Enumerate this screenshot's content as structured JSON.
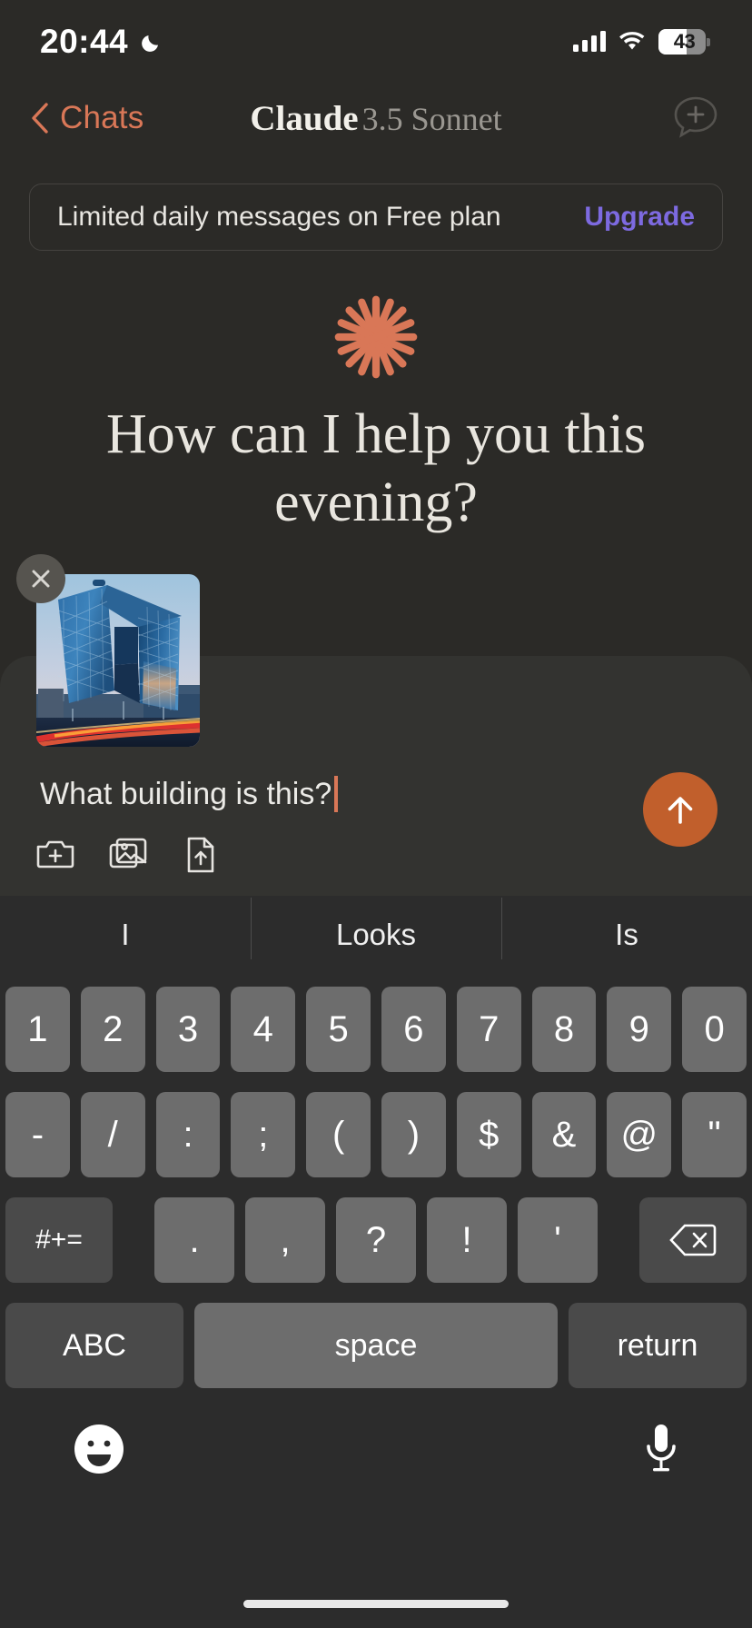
{
  "statusbar": {
    "time": "20:44",
    "moon_icon": "crescent-moon-icon",
    "signal_icon": "cellular-signal-icon",
    "wifi_icon": "wifi-icon",
    "battery_percent": "43",
    "battery_fill_ratio": 0.6
  },
  "header": {
    "back_label": "Chats",
    "back_icon": "chevron-left-icon",
    "title_main": "Claude",
    "title_sub": "3.5 Sonnet",
    "new_chat_icon": "new-chat-icon"
  },
  "banner": {
    "message": "Limited daily messages on Free plan",
    "cta_label": "Upgrade",
    "cta_color": "#7d6ae0"
  },
  "hero": {
    "logo_icon": "claude-starburst-icon",
    "logo_color": "#d97757",
    "greeting": "How can I help you this evening?"
  },
  "composer": {
    "attachment": {
      "remove_icon": "close-icon",
      "image_alt": "CCTV Headquarters building at dusk"
    },
    "input_value": "What building is this?",
    "caret_color": "#d97757",
    "tools": [
      {
        "icon": "camera-add-icon",
        "label": "Take photo"
      },
      {
        "icon": "photo-library-icon",
        "label": "Photo library"
      },
      {
        "icon": "file-upload-icon",
        "label": "Upload file"
      }
    ],
    "send_icon": "arrow-up-icon",
    "send_color": "#c15f2c"
  },
  "keyboard": {
    "suggestions": [
      "I",
      "Looks",
      "Is"
    ],
    "rows": [
      [
        "1",
        "2",
        "3",
        "4",
        "5",
        "6",
        "7",
        "8",
        "9",
        "0"
      ],
      [
        "-",
        "/",
        ":",
        ";",
        "(",
        ")",
        "$",
        "&",
        "@",
        "\""
      ],
      [
        "#+=",
        ".",
        ",",
        "?",
        "!",
        "'",
        "delete-icon"
      ],
      [
        "ABC",
        "space",
        "return"
      ]
    ],
    "emoji_icon": "emoji-smiley-icon",
    "mic_icon": "microphone-icon"
  }
}
